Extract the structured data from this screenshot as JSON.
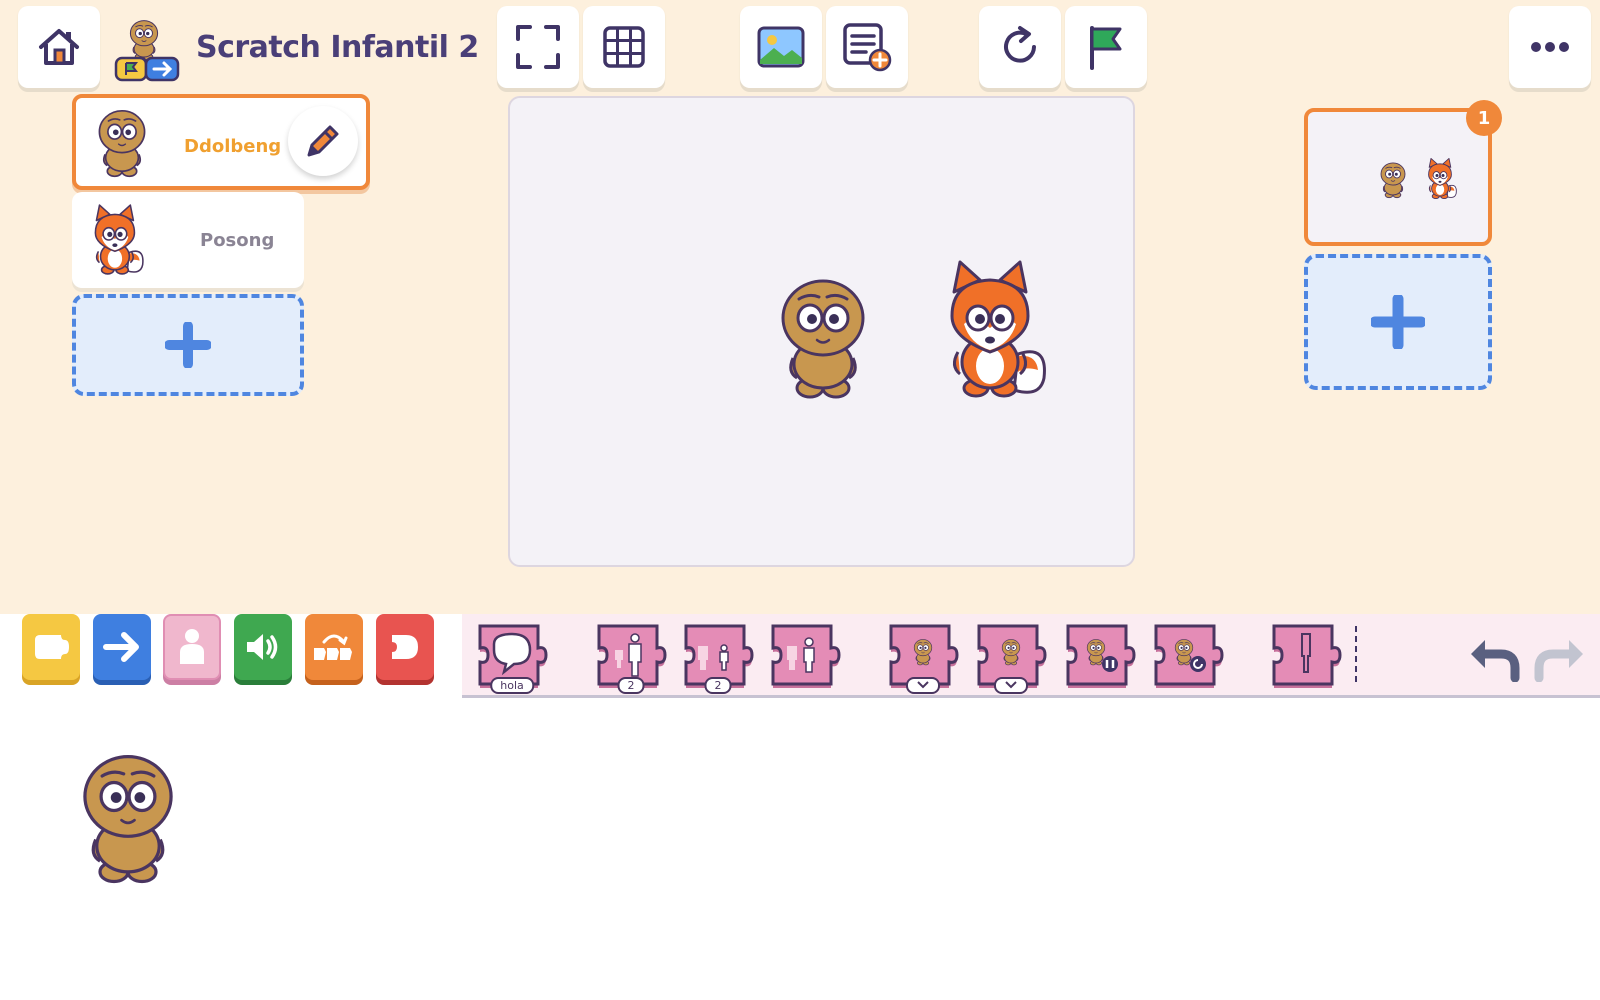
{
  "app": {
    "title": "Scratch Infantil 2"
  },
  "toolbar": {
    "home_icon": "home-icon",
    "fullscreen_icon": "fullscreen-icon",
    "grid_icon": "grid-icon",
    "background_icon": "image-icon",
    "add_text_icon": "add-text-icon",
    "reset_icon": "reset-icon",
    "green_flag_icon": "green-flag-icon",
    "more_icon": "more-icon"
  },
  "sprites": [
    {
      "name": "Ddolbeng",
      "selected": true
    },
    {
      "name": "Posong",
      "selected": false
    }
  ],
  "scenes": {
    "badge": "1"
  },
  "palette": {
    "categories": [
      "triggers",
      "motion",
      "looks",
      "sound",
      "control",
      "end"
    ],
    "blocks": [
      {
        "name": "say-block",
        "label": "hola"
      },
      {
        "name": "grow-block",
        "label": "2"
      },
      {
        "name": "shrink-block",
        "label": "2"
      },
      {
        "name": "reset-size-block",
        "label": ""
      },
      {
        "name": "hide-block",
        "label": ""
      },
      {
        "name": "show-block",
        "label": ""
      },
      {
        "name": "pause-block",
        "label": ""
      },
      {
        "name": "reset-block",
        "label": ""
      },
      {
        "name": "partial-block",
        "label": ""
      }
    ]
  },
  "colors": {
    "accent_orange": "#f0883a",
    "add_blue": "#4f86e0",
    "looks_pink": "#e48cb6"
  }
}
